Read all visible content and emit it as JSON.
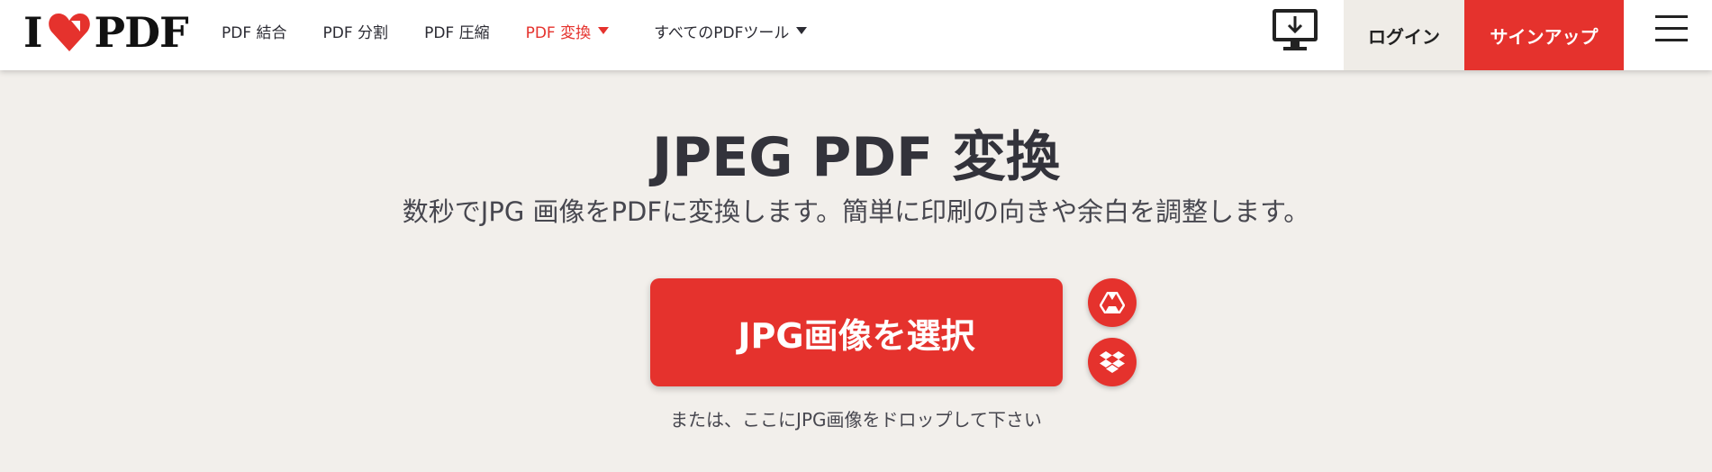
{
  "header": {
    "logo": {
      "left": "I",
      "right": "PDF"
    },
    "nav": [
      {
        "label": "PDF 結合",
        "active": false,
        "dropdown": false
      },
      {
        "label": "PDF 分割",
        "active": false,
        "dropdown": false
      },
      {
        "label": "PDF 圧縮",
        "active": false,
        "dropdown": false
      },
      {
        "label": "PDF 変換",
        "active": true,
        "dropdown": true
      },
      {
        "label": "すべてのPDFツール",
        "active": false,
        "dropdown": true
      }
    ],
    "desktop_icon": "desktop-download-icon",
    "login_label": "ログイン",
    "signup_label": "サインアップ",
    "menu_icon": "hamburger-menu-icon"
  },
  "main": {
    "title": "JPEG PDF 変換",
    "subtitle": "数秒でJPG 画像をPDFに変換します。簡単に印刷の向きや余白を調整します。",
    "select_button_label": "JPG画像を選択",
    "cloud_buttons": [
      "google-drive-icon",
      "dropbox-icon"
    ],
    "drop_hint": "または、ここにJPG画像をドロップして下さい"
  },
  "colors": {
    "accent": "#e5322d",
    "background": "#f2efeb",
    "text": "#33333b"
  }
}
